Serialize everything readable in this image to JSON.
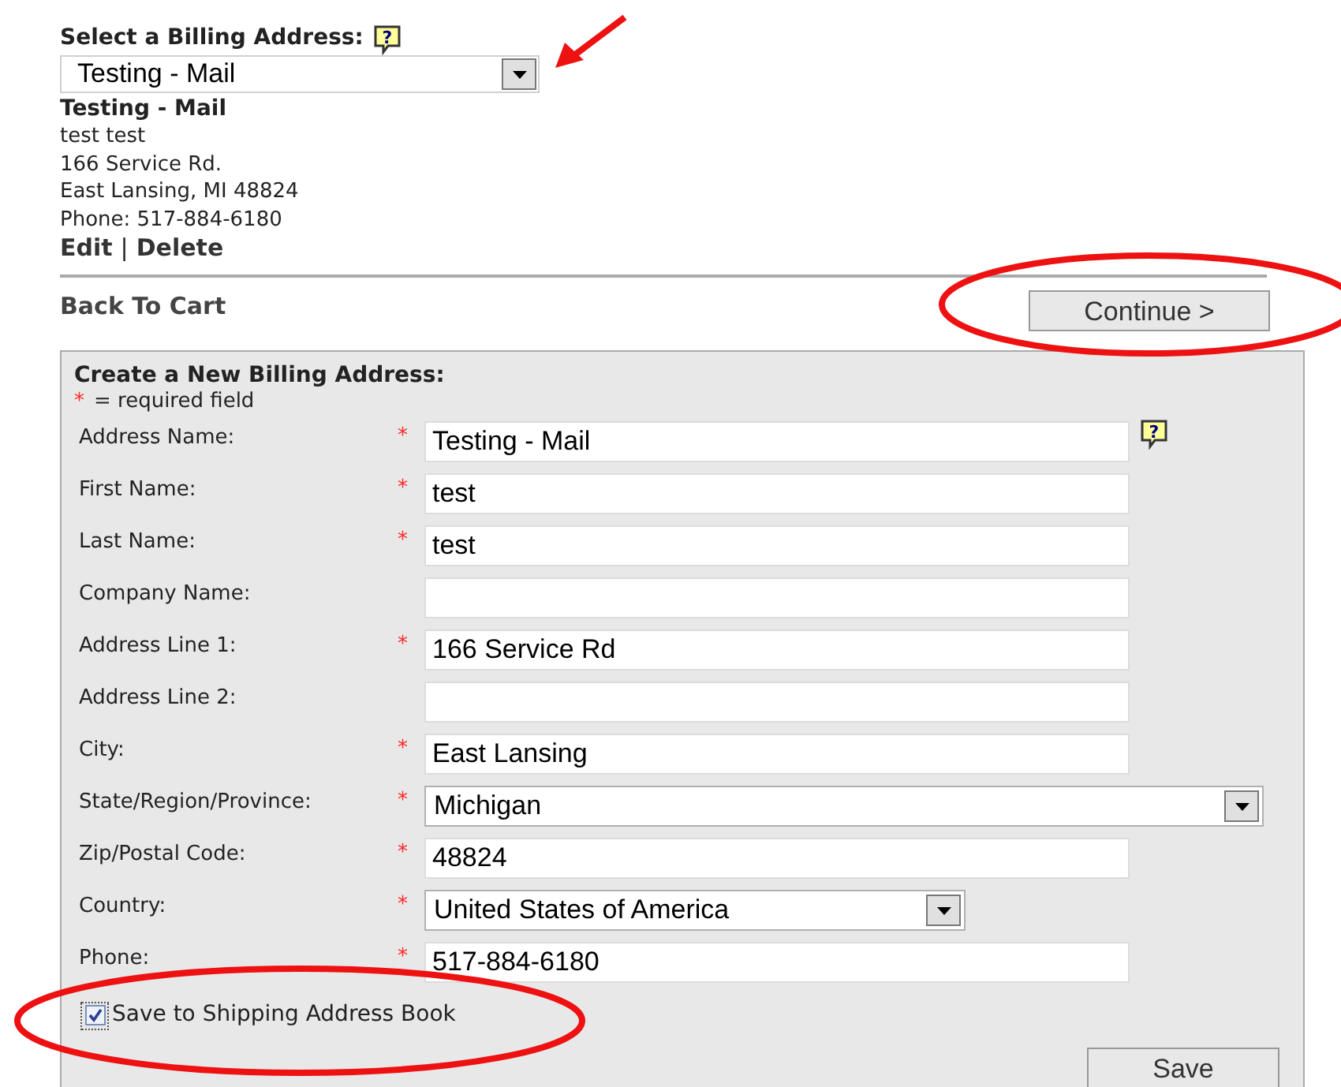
{
  "billing_select": {
    "label": "Select a Billing Address:",
    "value": "Testing - Mail"
  },
  "address": {
    "name": "Testing - Mail",
    "lines": [
      "test test",
      "166 Service Rd.",
      "East Lansing, MI 48824",
      "Phone: 517-884-6180"
    ],
    "edit": "Edit",
    "separator": "|",
    "delete": "Delete"
  },
  "help_mark": "?",
  "back_link": "Back To Cart",
  "continue_button": "Continue >",
  "form": {
    "title": "Create a New Billing Address:",
    "required_mark": "*",
    "required_note": "= required field",
    "fields": [
      {
        "label": "Address Name:",
        "required": true,
        "kind": "text",
        "value": "Testing - Mail",
        "help": true
      },
      {
        "label": "First Name:",
        "required": true,
        "kind": "text",
        "value": "test",
        "help": false
      },
      {
        "label": "Last Name:",
        "required": true,
        "kind": "text",
        "value": "test",
        "help": false
      },
      {
        "label": "Company Name:",
        "required": false,
        "kind": "text",
        "help": false
      },
      {
        "label": "Address Line 1:",
        "required": true,
        "kind": "text",
        "value": "166 Service Rd",
        "help": false
      },
      {
        "label": "Address Line 2:",
        "required": false,
        "kind": "text",
        "help": false
      },
      {
        "label": "City:",
        "required": true,
        "kind": "text",
        "value": "East Lansing",
        "help": false
      },
      {
        "label": "State/Region/Province:",
        "required": true,
        "kind": "select",
        "value": "Michigan",
        "help": false
      },
      {
        "label": "Zip/Postal Code:",
        "required": true,
        "kind": "text",
        "value": "48824",
        "help": false
      },
      {
        "label": "Country:",
        "required": true,
        "kind": "select",
        "value": "United States of America",
        "help": false
      },
      {
        "label": "Phone:",
        "required": true,
        "kind": "text",
        "value": "517-884-6180",
        "help": false
      }
    ],
    "save_to_shipping": {
      "label": "Save to Shipping Address Book",
      "checked": true
    },
    "save_button": "Save"
  }
}
